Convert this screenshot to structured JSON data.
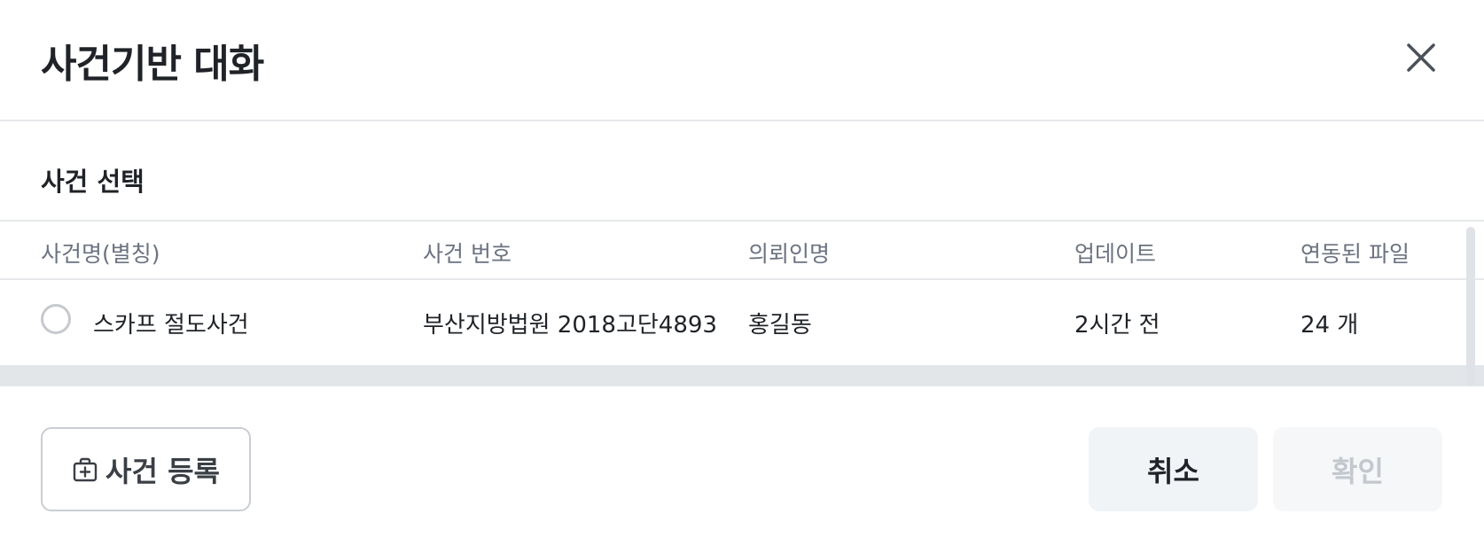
{
  "dialog": {
    "title": "사건기반 대화",
    "close_icon": "close-icon"
  },
  "section": {
    "title": "사건 선택"
  },
  "table": {
    "columns": [
      "사건명(별칭)",
      "사건 번호",
      "의뢰인명",
      "업데이트",
      "연동된 파일"
    ],
    "rows": [
      {
        "selected": false,
        "name": "스카프 절도사건",
        "case_number": "부산지방법원 2018고단4893",
        "client": "홍길동",
        "updated": "2시간 전",
        "files": "24 개"
      }
    ]
  },
  "footer": {
    "register_label": "사건 등록",
    "register_icon": "briefcase-plus-icon",
    "cancel_label": "취소",
    "confirm_label": "확인"
  },
  "colors": {
    "text": "#1f2328",
    "muted": "#6b7280",
    "divider": "#e6e8eb",
    "cancel_bg": "#f1f4f7",
    "disabled_text": "#c3c8ce"
  }
}
